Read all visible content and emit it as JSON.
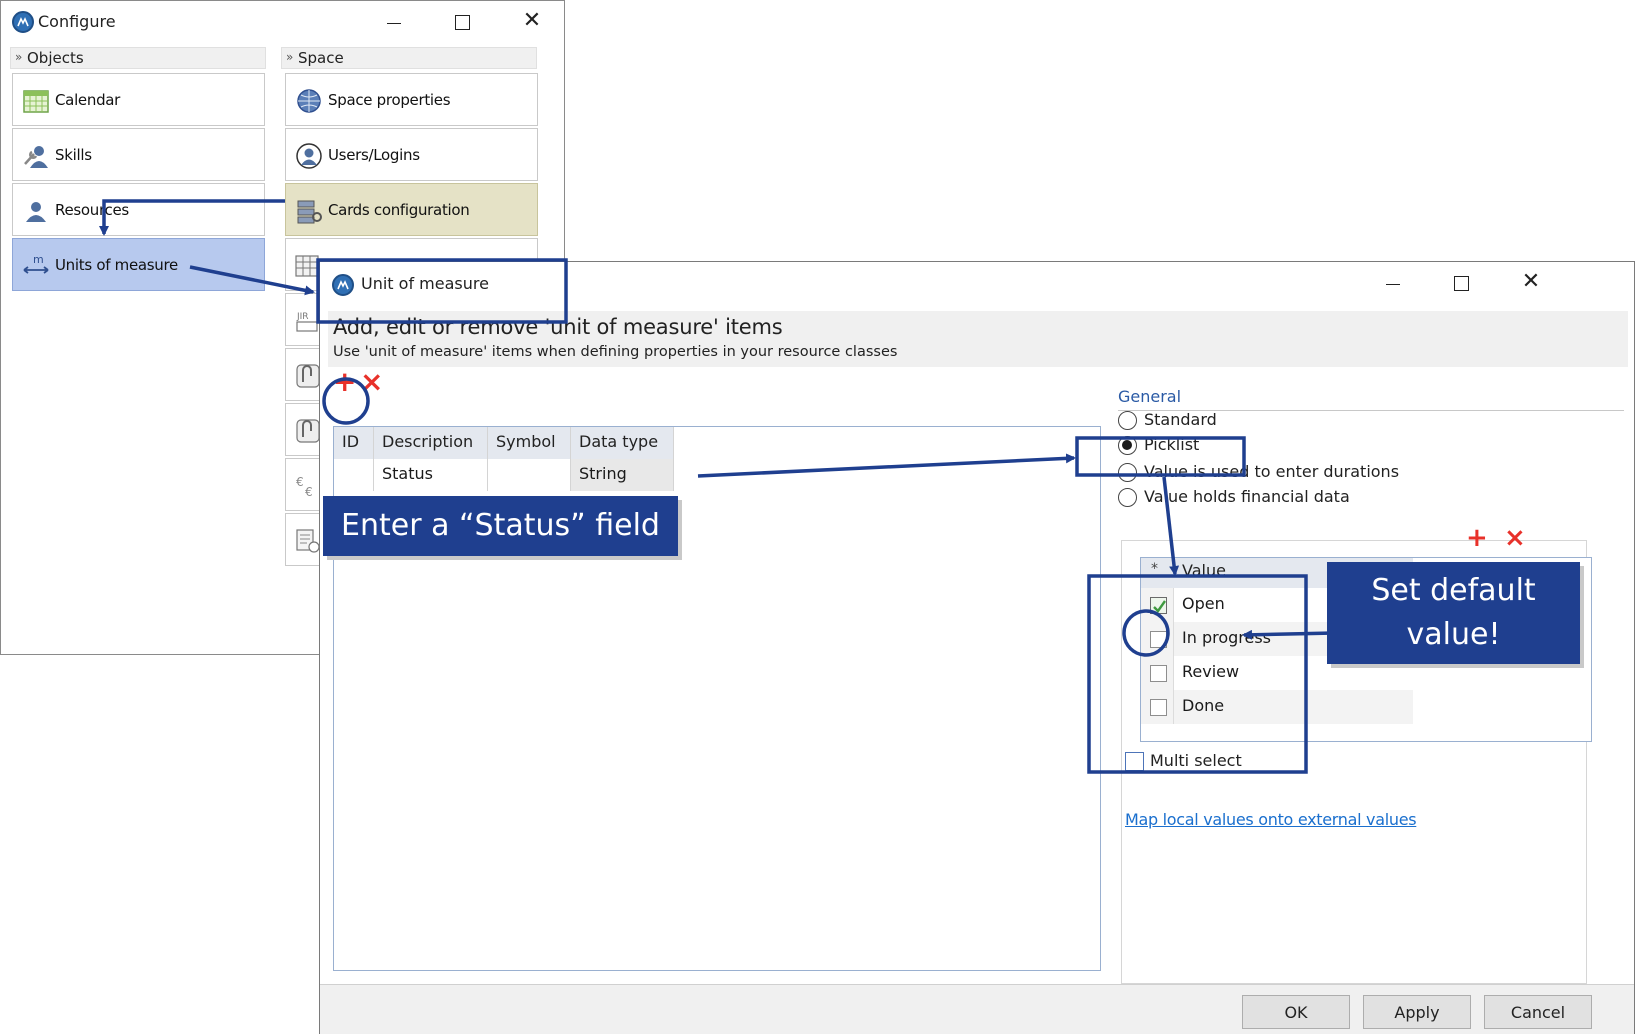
{
  "configure": {
    "title": "Configure",
    "sections": {
      "objects": "Objects",
      "space": "Space"
    },
    "objects_tiles": [
      "Calendar",
      "Skills",
      "Resources",
      "Units of measure"
    ],
    "space_tiles": [
      "Space properties",
      "Users/Logins",
      "Cards configuration"
    ],
    "partial_icons": [
      "calendar-grid-icon",
      "jira-icon",
      "wrench-icon",
      "wrench-icon",
      "currency-icon",
      "report-clock-icon"
    ]
  },
  "uom": {
    "title": "Unit of measure",
    "header_title": "Add, edit or remove 'unit of measure' items",
    "header_sub": "Use 'unit of measure' items when defining properties in your resource classes",
    "toolbar": {
      "add": "+",
      "delete": "×"
    },
    "grid": {
      "columns": [
        "ID",
        "Description",
        "Symbol",
        "Data type"
      ],
      "rows": [
        {
          "id": "",
          "description": "Status",
          "symbol": "",
          "data_type": "String"
        }
      ]
    },
    "general": {
      "label": "General",
      "options": [
        "Standard",
        "Picklist",
        "Value is used to enter durations",
        "Value holds financial data"
      ],
      "selected": "Picklist"
    },
    "picklist": {
      "add": "+",
      "delete": "×",
      "star": "*",
      "column": "Value",
      "values": [
        {
          "label": "Open",
          "checked": true
        },
        {
          "label": "In progress",
          "checked": false
        },
        {
          "label": "Review",
          "checked": false
        },
        {
          "label": "Done",
          "checked": false
        }
      ]
    },
    "multi_select": "Multi select",
    "map_link": "Map local values onto external values",
    "buttons": {
      "ok": "OK",
      "apply": "Apply",
      "cancel": "Cancel"
    }
  },
  "annotations": {
    "status_callout": "Enter a “Status” field",
    "default_callout_line1": "Set default",
    "default_callout_line2": "value!"
  },
  "colors": {
    "accent_blue": "#1f3f8f",
    "selected_tile": "#b7c9ee",
    "highlight_tile": "#e5e2c6",
    "delete_red": "#e8312a",
    "link": "#1a6fce"
  }
}
